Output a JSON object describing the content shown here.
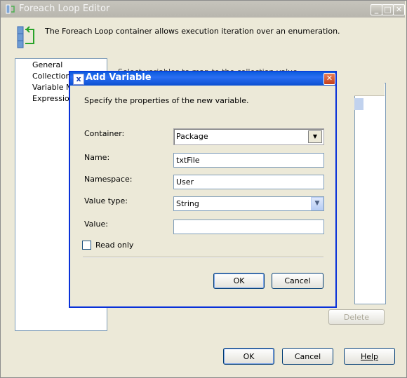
{
  "parent": {
    "title": "Foreach Loop Editor",
    "description": "The Foreach Loop container allows execution iteration over an enumeration.",
    "nav_items": [
      "General",
      "Collection",
      "Variable Ma",
      "Expression"
    ],
    "background_label": "Select variables to map to the collection value.",
    "delete_label": "Delete",
    "ok_label": "OK",
    "cancel_label": "Cancel",
    "help_label": "Help"
  },
  "dialog": {
    "title": "Add Variable",
    "description": "Specify the properties of the new variable.",
    "container_label": "Container:",
    "container_value": "Package",
    "name_label": "Name:",
    "name_value": "txtFile",
    "namespace_label": "Namespace:",
    "namespace_value": "User",
    "value_type_label": "Value type:",
    "value_type_value": "String",
    "value_label": "Value:",
    "value_value": "",
    "read_only_label": "Read only",
    "read_only_checked": false,
    "ok_label": "OK",
    "cancel_label": "Cancel"
  },
  "colors": {
    "dialog_title_bar": "#0a5bdc",
    "window_face": "#ece9d8",
    "inactive_title": "#c6c4bc",
    "close_button": "#d2532e",
    "selection": "#c1d2ee"
  }
}
